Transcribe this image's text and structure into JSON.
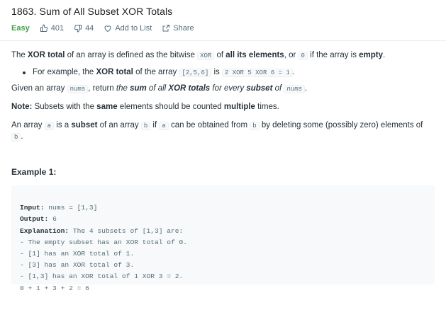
{
  "problem": {
    "title": "1863. Sum of All Subset XOR Totals",
    "difficulty": "Easy",
    "likes": "401",
    "dislikes": "44",
    "add_to_list": "Add to List",
    "share": "Share"
  },
  "description": {
    "p1": {
      "t1": "The ",
      "b1": "XOR total",
      "t2": " of an array is defined as the bitwise ",
      "c1": "XOR",
      "t3": " of ",
      "b2": "all its elements",
      "t4": ", or ",
      "c2": "0",
      "t5": " if the array is ",
      "b3": "empty",
      "t6": "."
    },
    "bullet": {
      "t1": "For example, the ",
      "b1": "XOR total",
      "t2": " of the array ",
      "c1": "[2,5,6]",
      "t3": " is ",
      "c2": "2 XOR 5 XOR 6 = 1",
      "t4": "."
    },
    "p2": {
      "t1": "Given an array ",
      "c1": "nums",
      "t2": ", return ",
      "t3": "the ",
      "b1": "sum",
      "t4": " of all ",
      "b2": "XOR totals",
      "t5": " for every ",
      "b3": "subset",
      "t6": " of ",
      "c2": "nums",
      "t7": "."
    },
    "note": {
      "label": "Note:",
      "t1": " Subsets with the ",
      "b1": "same",
      "t2": " elements should be counted ",
      "b2": "multiple",
      "t3": " times."
    },
    "p3": {
      "t1": "An array ",
      "c1": "a",
      "t2": " is a ",
      "b1": "subset",
      "t3": " of an array ",
      "c2": "b",
      "t4": " if ",
      "c3": "a",
      "t5": " can be obtained from ",
      "c4": "b",
      "t6": " by deleting some (possibly zero) elements of ",
      "c5": "b",
      "t7": "."
    }
  },
  "example": {
    "heading": "Example 1:",
    "input_label": "Input:",
    "input_value": " nums = [1,3]",
    "output_label": "Output:",
    "output_value": " 6",
    "explanation_label": "Explanation:",
    "explanation_value": " The 4 subsets of [1,3] are:",
    "lines": [
      "- The empty subset has an XOR total of 0.",
      "- [1] has an XOR total of 1.",
      "- [3] has an XOR total of 3.",
      "- [1,3] has an XOR total of 1 XOR 3 = 2.",
      "0 + 1 + 3 + 2 = 6"
    ]
  },
  "colors": {
    "easy": "#43a047",
    "text": "#263238",
    "muted": "#546e7a",
    "code_bg": "#f7f9fa"
  },
  "icons": [
    "thumbs-up-icon",
    "thumbs-down-icon",
    "heart-icon",
    "share-icon"
  ]
}
